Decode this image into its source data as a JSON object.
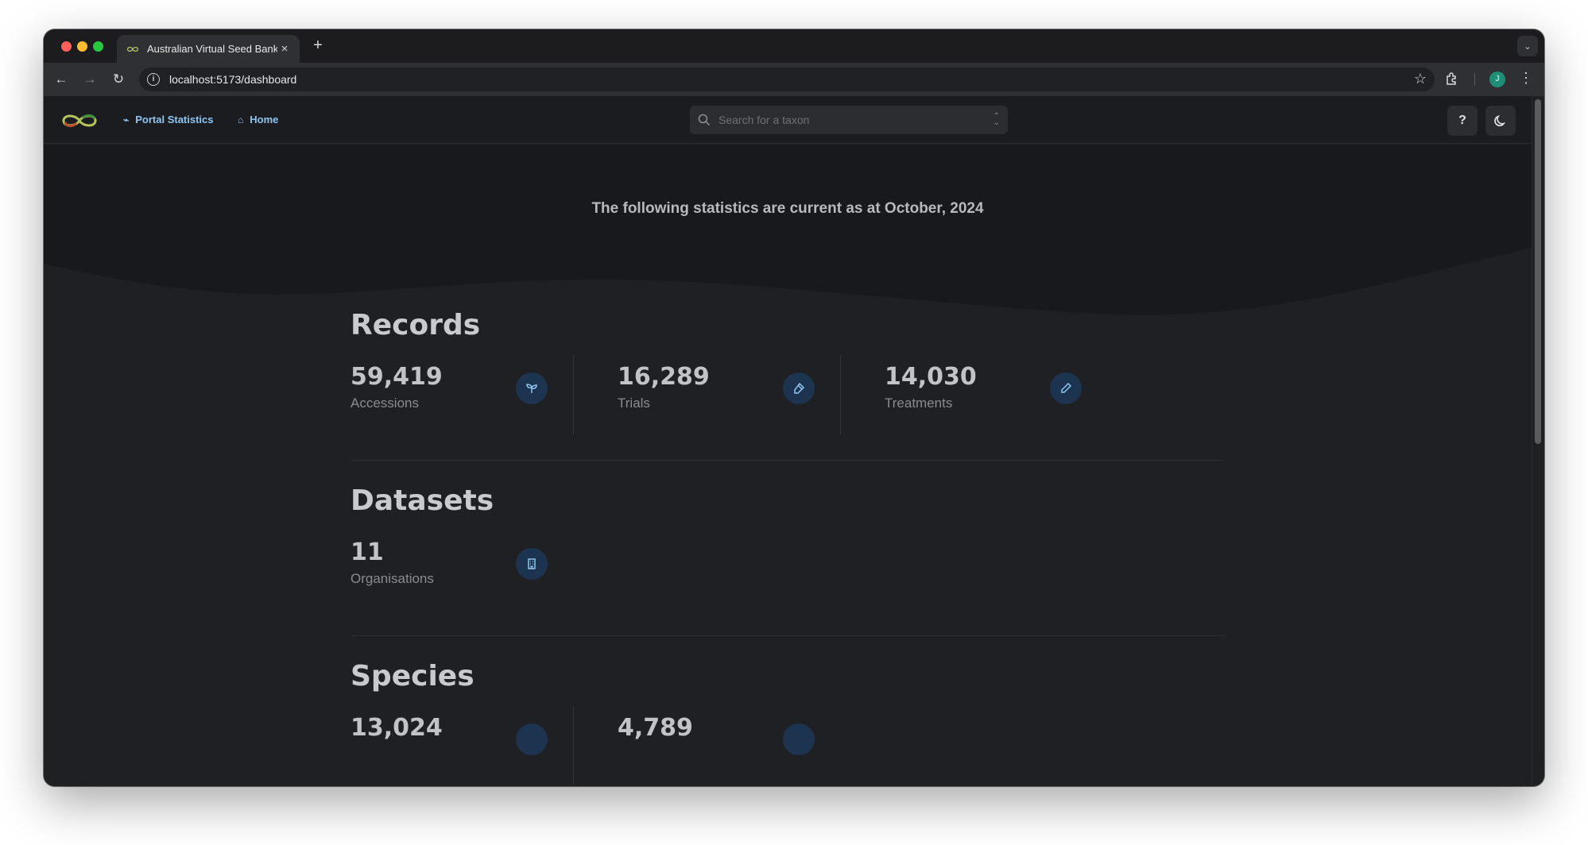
{
  "browser": {
    "tab_title": "Australian Virtual Seed Bank",
    "tab_close": "×",
    "new_tab": "+",
    "url": "localhost:5173/dashboard",
    "profile_initial": "J"
  },
  "appbar": {
    "nav": [
      {
        "label": "Portal Statistics",
        "icon": "chart-icon"
      },
      {
        "label": "Home",
        "icon": "home-icon"
      }
    ],
    "search_placeholder": "Search for a taxon",
    "help_label": "?"
  },
  "hero": {
    "text": "The following statistics are current as at October, 2024"
  },
  "sections": {
    "records": {
      "title": "Records",
      "stats": [
        {
          "value": "59,419",
          "label": "Accessions",
          "icon": "seedling-icon"
        },
        {
          "value": "16,289",
          "label": "Trials",
          "icon": "flask-icon"
        },
        {
          "value": "14,030",
          "label": "Treatments",
          "icon": "pencil-icon"
        }
      ]
    },
    "datasets": {
      "title": "Datasets",
      "stats": [
        {
          "value": "11",
          "label": "Organisations",
          "icon": "building-icon"
        }
      ]
    },
    "species": {
      "title": "Species",
      "stats": [
        {
          "value": "13,024",
          "label": "",
          "icon": "leaf-icon"
        },
        {
          "value": "4,789",
          "label": "",
          "icon": "leaf-icon"
        }
      ]
    }
  },
  "colors": {
    "accent": "#8fc5f0",
    "icon_bg": "#1d3450",
    "page_bg": "#1f2024",
    "hero_bg": "#18191c"
  }
}
